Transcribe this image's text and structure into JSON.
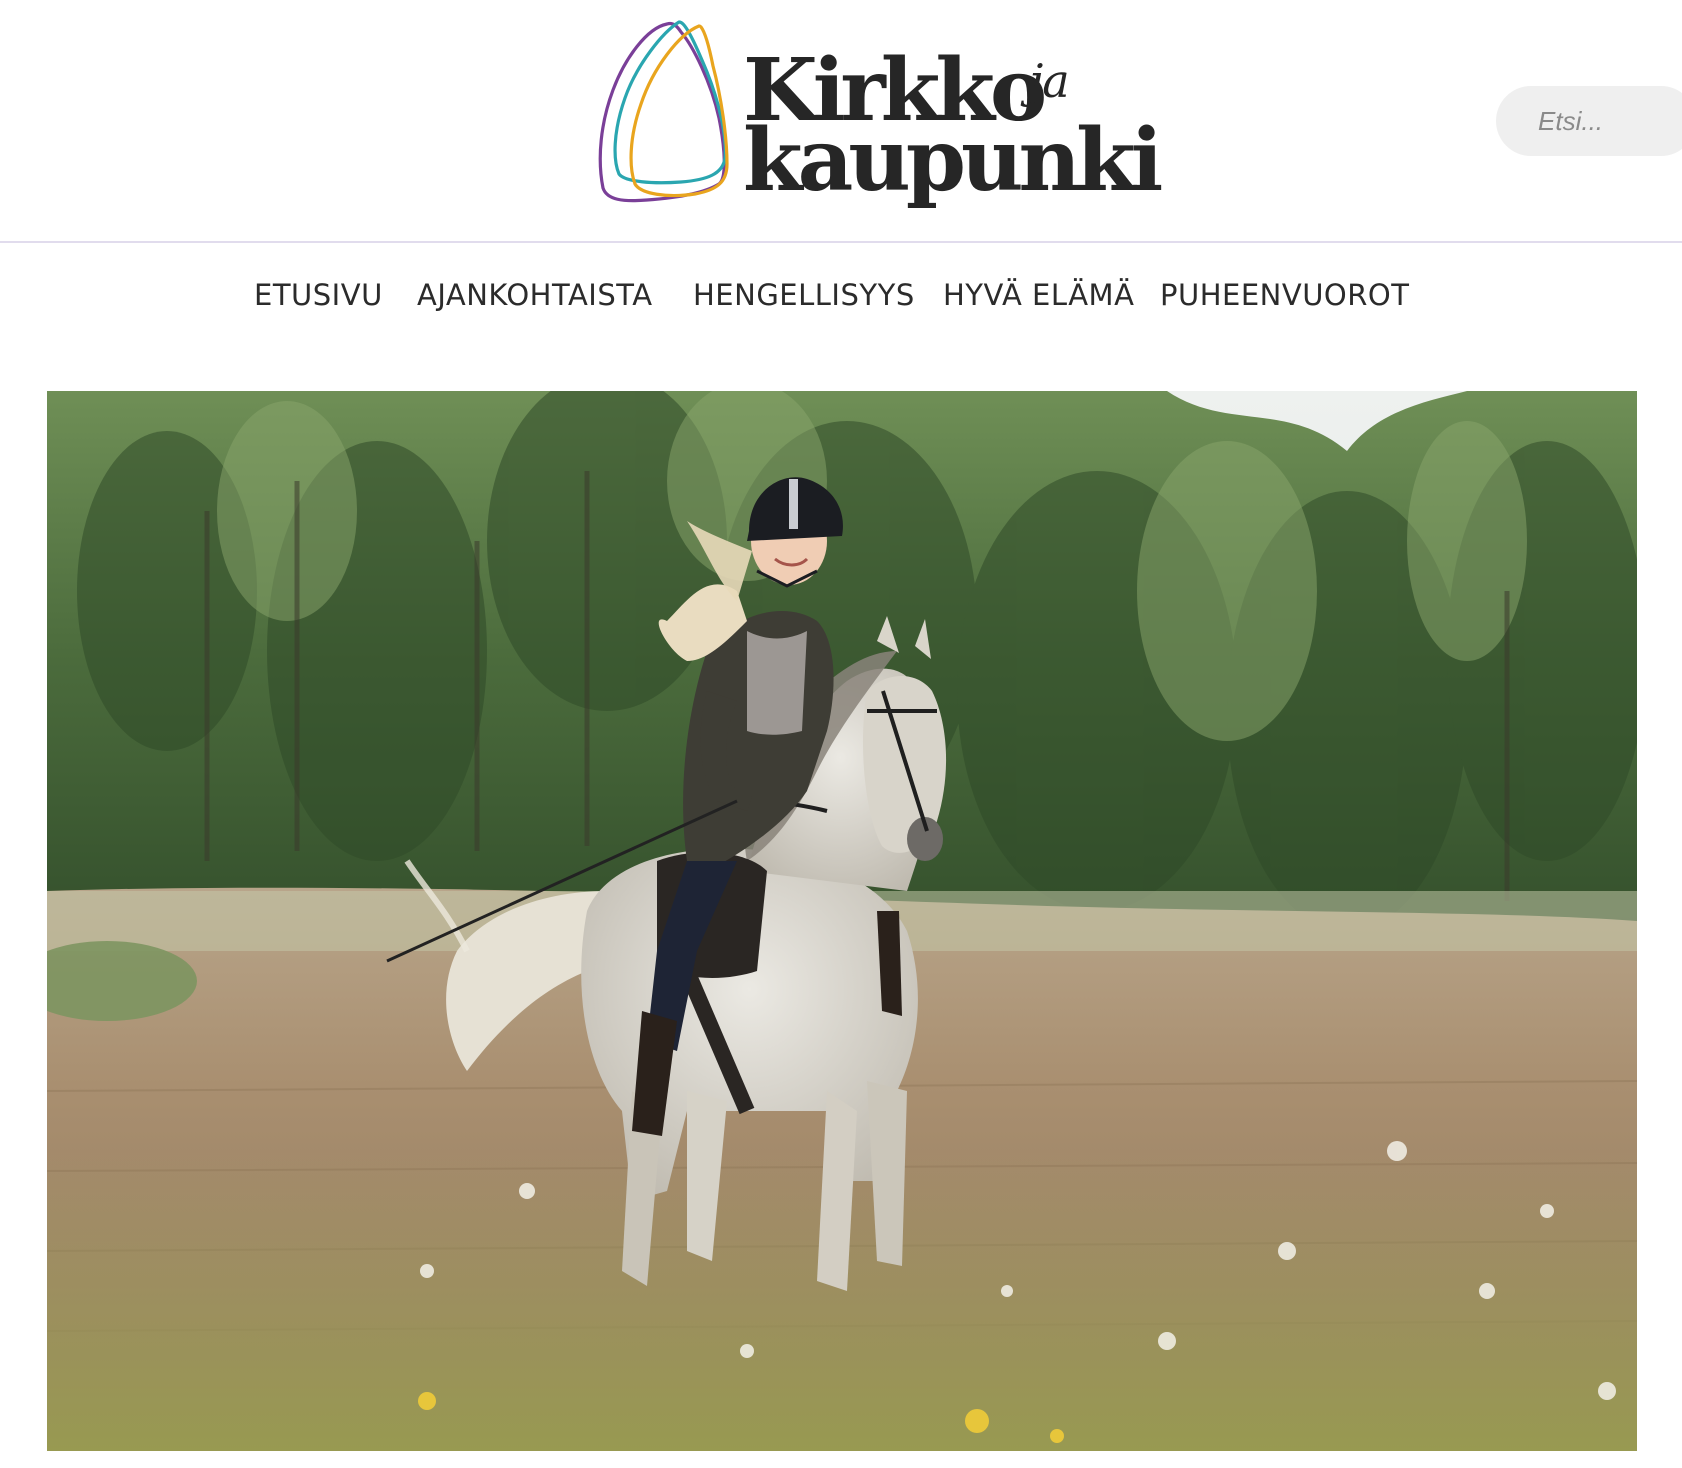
{
  "site": {
    "logo_line_1": "Kirkko",
    "logo_line_2": "kaupunki",
    "logo_ja": "ja",
    "logo_colors": {
      "purple": "#7a3f98",
      "teal": "#2aa6b0",
      "gold": "#e9a51e"
    }
  },
  "search": {
    "placeholder": "Etsi..."
  },
  "nav": {
    "items": [
      {
        "label": "ETUSIVU"
      },
      {
        "label": "AJANKOHTAISTA"
      },
      {
        "label": "HENGELLISYYS"
      },
      {
        "label": "HYVÄ ELÄMÄ"
      },
      {
        "label": "PUHEENVUOROT"
      }
    ]
  },
  "colors": {
    "text": "#2b2b2b",
    "divider": "#e1dced",
    "search_bg": "#efefef"
  }
}
